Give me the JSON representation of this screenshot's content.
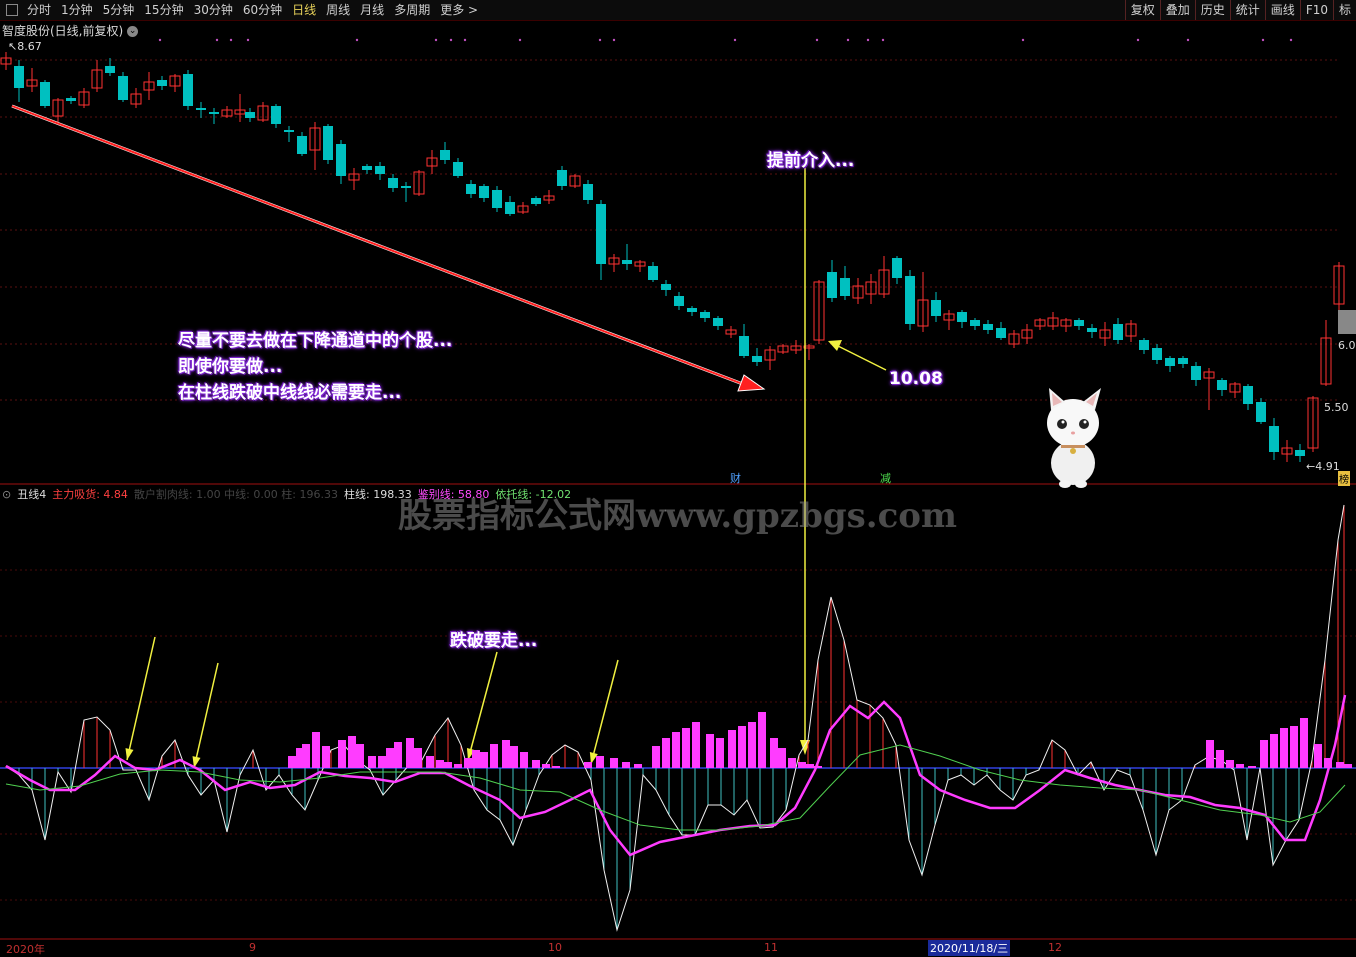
{
  "toolbar": {
    "periods": [
      "分时",
      "1分钟",
      "5分钟",
      "15分钟",
      "30分钟",
      "60分钟",
      "日线",
      "周线",
      "月线",
      "多周期",
      "更多 >"
    ],
    "active_period": "日线",
    "right_buttons": [
      "复权",
      "叠加",
      "历史",
      "统计",
      "画线",
      "F10",
      "标"
    ]
  },
  "stock": {
    "title": "智度股份(日线,前复权)",
    "high_label": "8.67",
    "low_label": "4.91"
  },
  "price_axis": [
    "6.0",
    "5.50"
  ],
  "markers": {
    "cai": "财",
    "jian": "减",
    "bang": "榜"
  },
  "indicator": {
    "name": "丑线4",
    "main": "主力吸货: 4.84",
    "faded": "散户割肉线: 1.00   中线: 0.00   柱: 196.33",
    "zhuxian": "柱线: 198.33",
    "jianbie": "鉴别线: 58.80",
    "yituo": "依托线: -12.02"
  },
  "annotations": {
    "a1": "尽量不要去做在下降通道中的个股...",
    "a2": "即使你要做...",
    "a3": "在柱线跌破中线线必需要走...",
    "early": "提前介入...",
    "price": "10.08",
    "break": "跌破要走..."
  },
  "watermark": "股票指标公式网www.gpzbgs.com",
  "dates": {
    "d2020": "2020年",
    "m9": "9",
    "m10": "10",
    "m11": "11",
    "m12": "12",
    "cursor": "2020/11/18/三"
  },
  "colors": {
    "up": "#ff3232",
    "down": "#00c0c0",
    "magenta": "#ff3cff",
    "annot_glow": "#8a2be2"
  }
}
